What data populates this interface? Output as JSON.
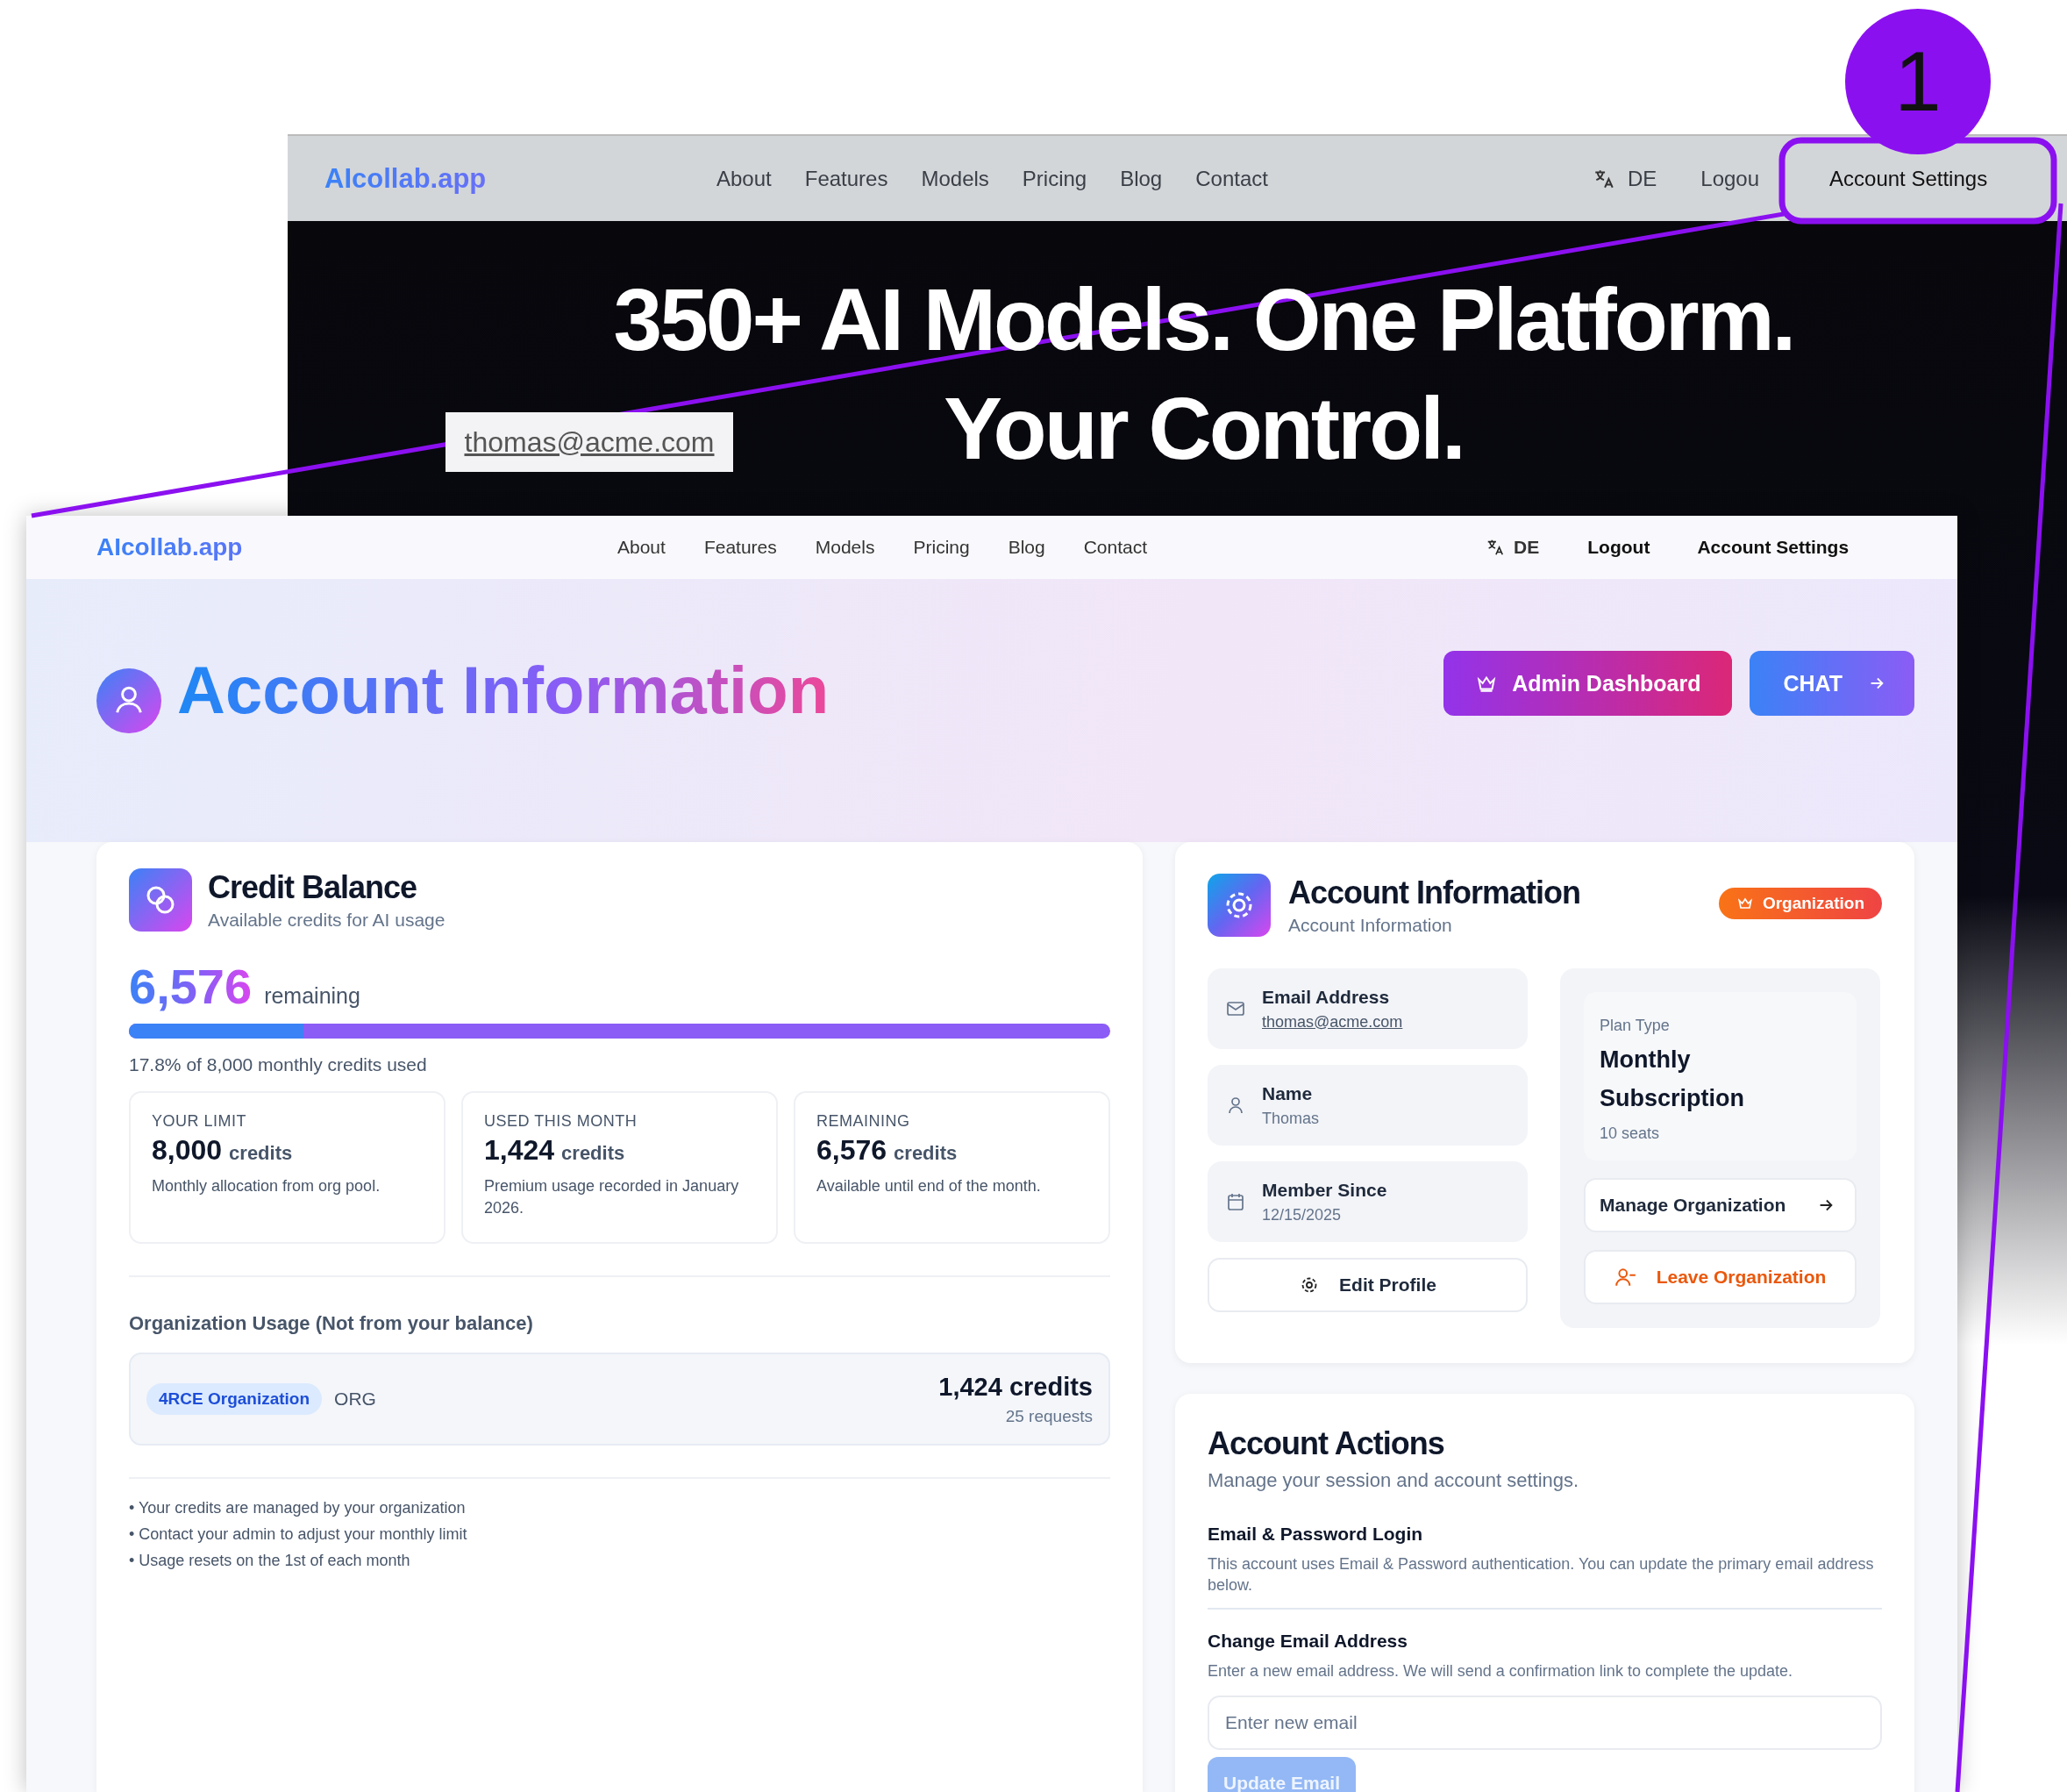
{
  "back_window": {
    "logo": "AIcollab.app",
    "nav_links": [
      "About",
      "Features",
      "Models",
      "Pricing",
      "Blog",
      "Contact"
    ],
    "language": "DE",
    "logout": "Logou",
    "account_settings": "Account Settings",
    "hero_lines": [
      "350+ AI Models. One Platform.",
      "Your Control."
    ]
  },
  "callout": {
    "number": "1",
    "email_label": "thomas@acme.com"
  },
  "window": {
    "logo": "AIcollab.app",
    "nav_links": [
      "About",
      "Features",
      "Models",
      "Pricing",
      "Blog",
      "Contact"
    ],
    "language": "DE",
    "logout": "Logout",
    "account_settings": "Account Settings"
  },
  "header": {
    "title": "Account Information",
    "buttons": [
      {
        "label": "Admin Dashboard",
        "kind": "admin"
      },
      {
        "label": "CHAT",
        "kind": "chat"
      }
    ]
  },
  "credit_balance": {
    "title": "Credit Balance",
    "subtitle": "Available credits for AI usage",
    "remaining_value": "6,576",
    "remaining_label": "remaining",
    "usage": {
      "level": 0.178,
      "caption": "17.8% of 8,000 monthly credits used"
    },
    "stats": [
      {
        "label": "YOUR LIMIT",
        "value": "8,000",
        "unit": "credits",
        "note": "Monthly allocation from org pool."
      },
      {
        "label": "USED THIS MONTH",
        "value": "1,424",
        "unit": "credits",
        "note": "Premium usage recorded in January 2026."
      },
      {
        "label": "REMAINING",
        "value": "6,576",
        "unit": "credits",
        "note": "Available until end of the month."
      }
    ],
    "org_usage": {
      "heading": "Organization Usage (Not from your balance)",
      "org_name": "4RCE Organization",
      "org_type": "ORG",
      "credits": "1,424 credits",
      "requests": "25 requests"
    },
    "notes": [
      "• Your credits are managed by your organization",
      "• Contact your admin to adjust your monthly limit",
      "• Usage resets on the 1st of each month"
    ]
  },
  "account_info": {
    "title": "Account Information",
    "subtitle": "Account Information",
    "badge": "Organization",
    "fields": [
      {
        "kind": "email",
        "label": "Email Address",
        "value": "thomas@acme.com"
      },
      {
        "kind": "name",
        "label": "Name",
        "value": "Thomas"
      },
      {
        "kind": "date",
        "label": "Member Since",
        "value": "12/15/2025"
      }
    ],
    "edit_button": "Edit Profile",
    "plan": {
      "label": "Plan Type",
      "value": "Monthly Subscription",
      "seats": "10 seats"
    },
    "manage_button": "Manage Organization",
    "leave_button": "Leave Organization"
  },
  "account_actions": {
    "title": "Account Actions",
    "subtitle": "Manage your session and account settings.",
    "sections": [
      {
        "title": "Email & Password Login",
        "text": "This account uses Email & Password authentication. You can update the primary email address below."
      },
      {
        "title": "Change Email Address",
        "text": "Enter a new email address. We will send a confirmation link to complete the update."
      }
    ],
    "email_field": {
      "placeholder": "Enter new email"
    },
    "update_button": {
      "label": "Update Email",
      "disabled": true
    }
  }
}
